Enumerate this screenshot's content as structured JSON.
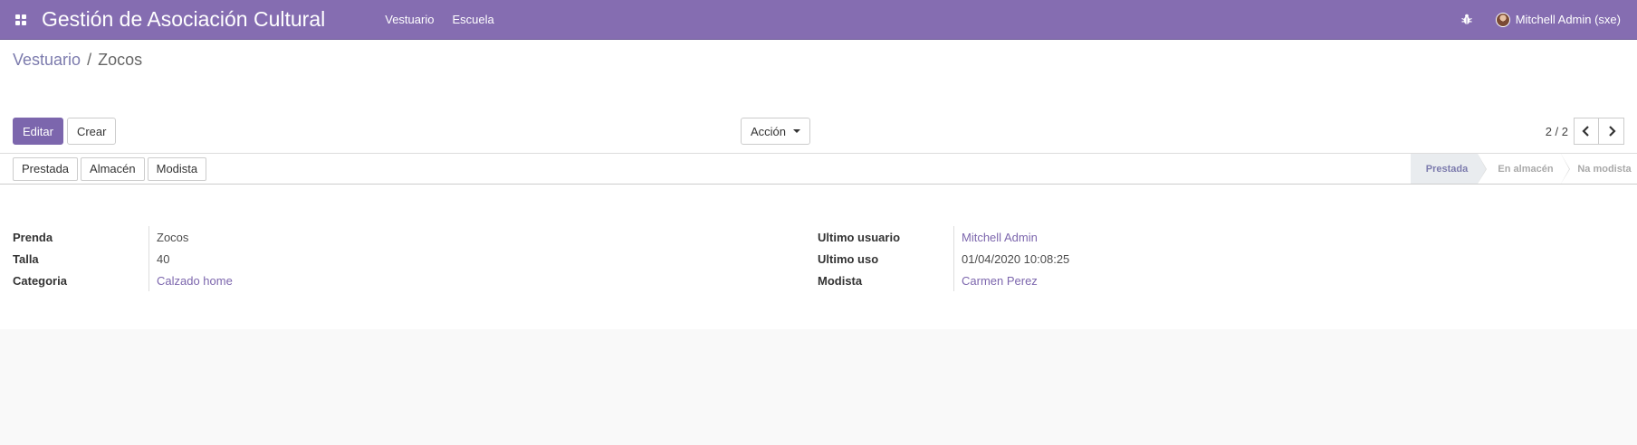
{
  "navbar": {
    "app_title": "Gestión de Asociación Cultural",
    "menu": [
      "Vestuario",
      "Escuela"
    ],
    "user_name": "Mitchell Admin (sxe)",
    "brand_color": "#856db1"
  },
  "breadcrumb": {
    "parent": "Vestuario",
    "separator": "/",
    "current": "Zocos"
  },
  "toolbar": {
    "edit_label": "Editar",
    "create_label": "Crear",
    "action_label": "Acción"
  },
  "pager": {
    "value": "2 / 2"
  },
  "statusbar": {
    "buttons": [
      "Prestada",
      "Almacén",
      "Modista"
    ],
    "stages": [
      {
        "label": "Prestada",
        "active": true
      },
      {
        "label": "En almacén",
        "active": false
      },
      {
        "label": "Na modista",
        "active": false
      }
    ]
  },
  "form": {
    "left": [
      {
        "label": "Prenda",
        "value": "Zocos",
        "link": false
      },
      {
        "label": "Talla",
        "value": "40",
        "link": false
      },
      {
        "label": "Categoria",
        "value": "Calzado home",
        "link": true
      }
    ],
    "right": [
      {
        "label": "Ultimo usuario",
        "value": "Mitchell Admin",
        "link": true
      },
      {
        "label": "Ultimo uso",
        "value": "01/04/2020 10:08:25",
        "link": false
      },
      {
        "label": "Modista",
        "value": "Carmen Perez",
        "link": true
      }
    ]
  },
  "icons": [
    "apps-icon",
    "bug-icon",
    "avatar",
    "chevron-left-icon",
    "chevron-right-icon",
    "caret-down-icon"
  ]
}
